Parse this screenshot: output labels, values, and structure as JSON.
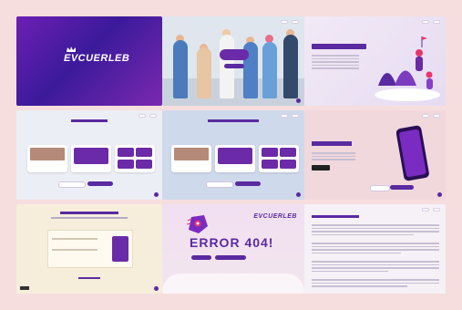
{
  "tiles": {
    "brand": {
      "logo": "EVCUERLEB"
    },
    "error": {
      "code_label": "ERROR 404!",
      "logo": "EVCUERLEB"
    }
  },
  "colors": {
    "primary": "#5a2aa0",
    "accent": "#e7356a",
    "background": "#f6dedf"
  }
}
